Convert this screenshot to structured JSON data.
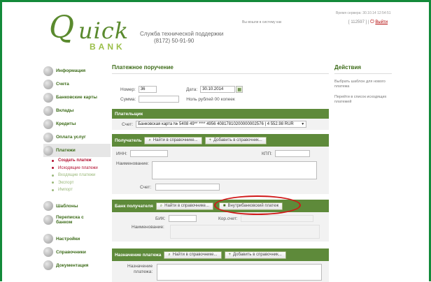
{
  "header": {
    "logo_q": "Q",
    "logo_uick": "uick",
    "logo_bank": "BANK",
    "support_label": "Служба технической поддержки",
    "support_phone": "(8172) 50-91-90",
    "login_as": "Вы вошли в систему как",
    "session_time": "Время сервера: 30.10.14 12:54:51",
    "user_id": "[ 112597 ] |",
    "logout": "Выйти"
  },
  "sidebar": {
    "items": [
      {
        "label": "Информация"
      },
      {
        "label": "Счета"
      },
      {
        "label": "Банковские карты"
      },
      {
        "label": "Вклады"
      },
      {
        "label": "Кредиты"
      },
      {
        "label": "Оплата услуг"
      },
      {
        "label": "Платежи"
      },
      {
        "label": "Шаблоны"
      },
      {
        "label1": "Переписка с",
        "label2": "банком"
      },
      {
        "label": "Настройки"
      },
      {
        "label": "Справочники"
      },
      {
        "label": "Документация"
      }
    ],
    "sub": [
      "Создать платеж",
      "Исходящие платежи",
      "Входящие платежи",
      "Экспорт",
      "Импорт"
    ]
  },
  "main": {
    "title": "Платежное поручение",
    "number_label": "Номер:",
    "number_value": "36",
    "date_label": "Дата:",
    "date_value": "30.10.2014",
    "sum_label": "Сумма:",
    "sum_words": "Ноль рублей 00 копеек",
    "payer_head": "Плательщик",
    "account_label": "Счет:",
    "account_value": "Банковская карта № 5408 49** **** 4956 40817810200000002576 | 4 552.98 RUR",
    "recipient_head": "Получатель",
    "find_btn": "Найти в справочнике...",
    "add_btn": "Добавить в справочник...",
    "inn_label": "ИНН:",
    "kpp_label": "КПП:",
    "name_label": "Наименование:",
    "acc_label": "Счет:",
    "bank_head": "Банк получателя",
    "intra_btn": "Внутрибанковский платеж",
    "bik_label": "БИК:",
    "kor_label": "Кор.счет:",
    "bank_name_label": "Наименование:",
    "purpose_head": "Назначение платежа",
    "purpose_label1": "Назначение",
    "purpose_label2": "платежа:"
  },
  "right": {
    "title": "Действия",
    "links": [
      "Выбрать шаблон для нового платежа",
      "Перейти в список исходящих платежей"
    ]
  }
}
